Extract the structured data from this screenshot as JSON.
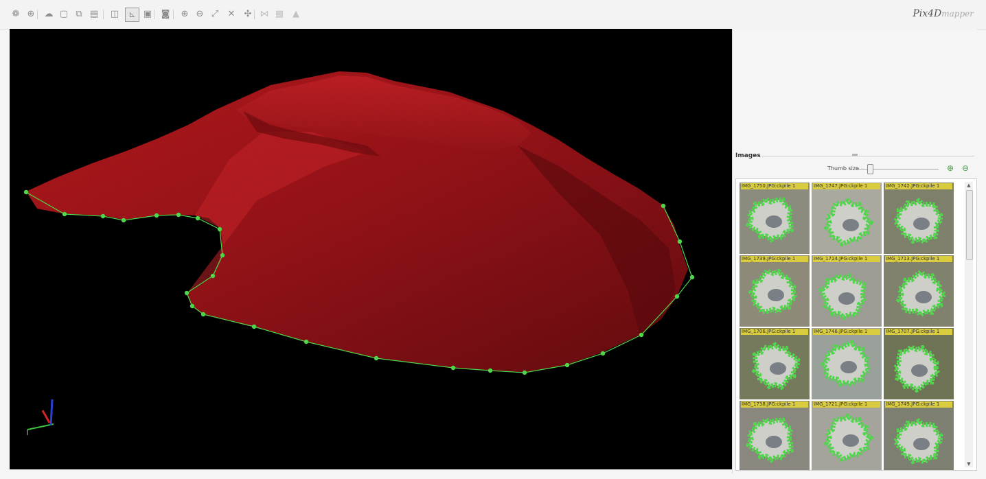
{
  "toolbar": {
    "buttons": [
      {
        "name": "layers-icon",
        "glyph": "❁",
        "active": false,
        "disabled": false
      },
      {
        "name": "crosshair-icon",
        "glyph": "⊕",
        "active": false,
        "disabled": false
      },
      {
        "name": "cloud-icon",
        "glyph": "☁",
        "active": false,
        "disabled": false
      },
      {
        "name": "square-outline-icon",
        "glyph": "▢",
        "active": false,
        "disabled": false
      },
      {
        "name": "copy-square-icon",
        "glyph": "⧉",
        "active": false,
        "disabled": false
      },
      {
        "name": "document-icon",
        "glyph": "▤",
        "active": false,
        "disabled": false
      },
      {
        "name": "split-view-icon",
        "glyph": "◫",
        "active": false,
        "disabled": false
      },
      {
        "name": "axes-view-icon",
        "glyph": "⊾",
        "active": true,
        "disabled": false
      },
      {
        "name": "image-view-icon",
        "glyph": "▣",
        "active": false,
        "disabled": false
      },
      {
        "name": "camera-icon",
        "glyph": "◙",
        "active": false,
        "disabled": false
      },
      {
        "name": "zoom-in-icon",
        "glyph": "⊕",
        "active": false,
        "disabled": false
      },
      {
        "name": "zoom-out-icon",
        "glyph": "⊖",
        "active": false,
        "disabled": false
      },
      {
        "name": "zoom-extent-icon",
        "glyph": "⤢",
        "active": false,
        "disabled": false
      },
      {
        "name": "fit-view-icon",
        "glyph": "✕",
        "active": false,
        "disabled": false
      },
      {
        "name": "navigate-icon",
        "glyph": "✣",
        "active": false,
        "disabled": false
      },
      {
        "name": "measure-icon",
        "glyph": "⋈",
        "active": false,
        "disabled": true
      },
      {
        "name": "grid-icon",
        "glyph": "▦",
        "active": false,
        "disabled": true
      },
      {
        "name": "triangle-icon",
        "glyph": "▲",
        "active": false,
        "disabled": true
      }
    ],
    "logo_main": "Pix4D",
    "logo_sub": "mapper"
  },
  "viewport": {
    "background": "#000000",
    "mesh_color": "#b31318",
    "polygon_color": "#4fd64a"
  },
  "images_panel": {
    "title": "Images",
    "thumb_size_label": "Thumb size",
    "thumb_size_level": 0.08,
    "zoom_in_glyph": "⊕",
    "zoom_out_glyph": "⊖",
    "scroll_up_glyph": "▲",
    "scroll_down_glyph": "▼",
    "thumbnails": [
      {
        "caption": "IMG_1750.JPG:ckpile 1"
      },
      {
        "caption": "IMG_1747.JPG:ckpile 1"
      },
      {
        "caption": "IMG_1742.JPG:ckpile 1"
      },
      {
        "caption": "IMG_1739.JPG:ckpile 1"
      },
      {
        "caption": "IMG_1714.JPG:ckpile 1"
      },
      {
        "caption": "IMG_1713.JPG:ckpile 1"
      },
      {
        "caption": "IMG_1706.JPG:ckpile 1"
      },
      {
        "caption": "IMG_1746.JPG:ckpile 1"
      },
      {
        "caption": "IMG_1707.JPG:ckpile 1"
      },
      {
        "caption": "IMG_1738.JPG:ckpile 1"
      },
      {
        "caption": "IMG_1721.JPG:ckpile 1"
      },
      {
        "caption": "IMG_1749.JPG:ckpile 1"
      }
    ]
  }
}
